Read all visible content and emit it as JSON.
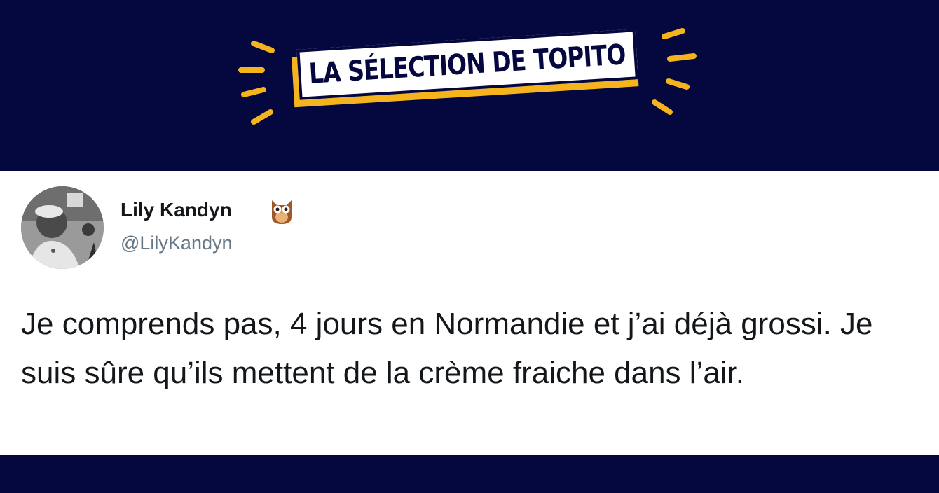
{
  "banner": {
    "label": "LA SÉLECTION DE TOPITO",
    "background_color": "#05073f",
    "accent_color": "#f5b41e",
    "ray_icon": "burst-rays-icon"
  },
  "tweet": {
    "author_name": "Lily Kandyn",
    "author_badge_icon": "owl-emoji-icon",
    "author_handle": "@LilyKandyn",
    "avatar_icon": "profile-photo-avatar",
    "text": "Je comprends pas, 4 jours en Normandie et j’ai déjà grossi. Je suis sûre qu’ils mettent de la crème fraiche dans l’air."
  }
}
